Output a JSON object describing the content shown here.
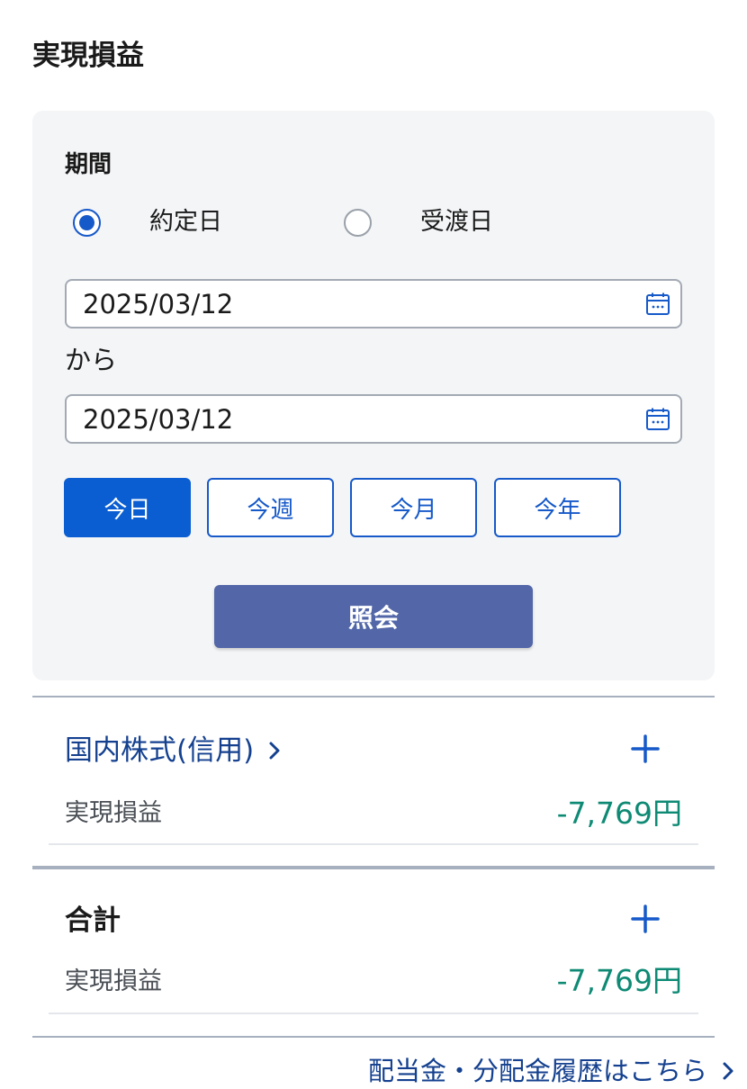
{
  "page": {
    "title": "実現損益"
  },
  "filter": {
    "period_label": "期間",
    "radio_options": [
      {
        "label": "約定日",
        "checked": true
      },
      {
        "label": "受渡日",
        "checked": false
      }
    ],
    "date_from": "2025/03/12",
    "separator": "から",
    "date_to": "2025/03/12",
    "quick_buttons": [
      {
        "label": "今日",
        "active": true
      },
      {
        "label": "今週",
        "active": false
      },
      {
        "label": "今月",
        "active": false
      },
      {
        "label": "今年",
        "active": false
      }
    ],
    "query_button": "照会"
  },
  "sections": [
    {
      "title": "国内株式(信用)",
      "row_label": "実現損益",
      "row_value": "-7,769円"
    },
    {
      "title": "合計",
      "row_label": "実現損益",
      "row_value": "-7,769円"
    }
  ],
  "footer": {
    "dividend_link": "配当金・分配金履歴はこちら"
  },
  "colors": {
    "accent_blue": "#1659c9",
    "link_navy": "#14408f",
    "query_button": "#5266a8",
    "loss_value": "#0e8a74"
  },
  "icons": {
    "calendar": "calendar-icon",
    "plus": "plus-icon",
    "chevron": "chevron-right-icon"
  }
}
